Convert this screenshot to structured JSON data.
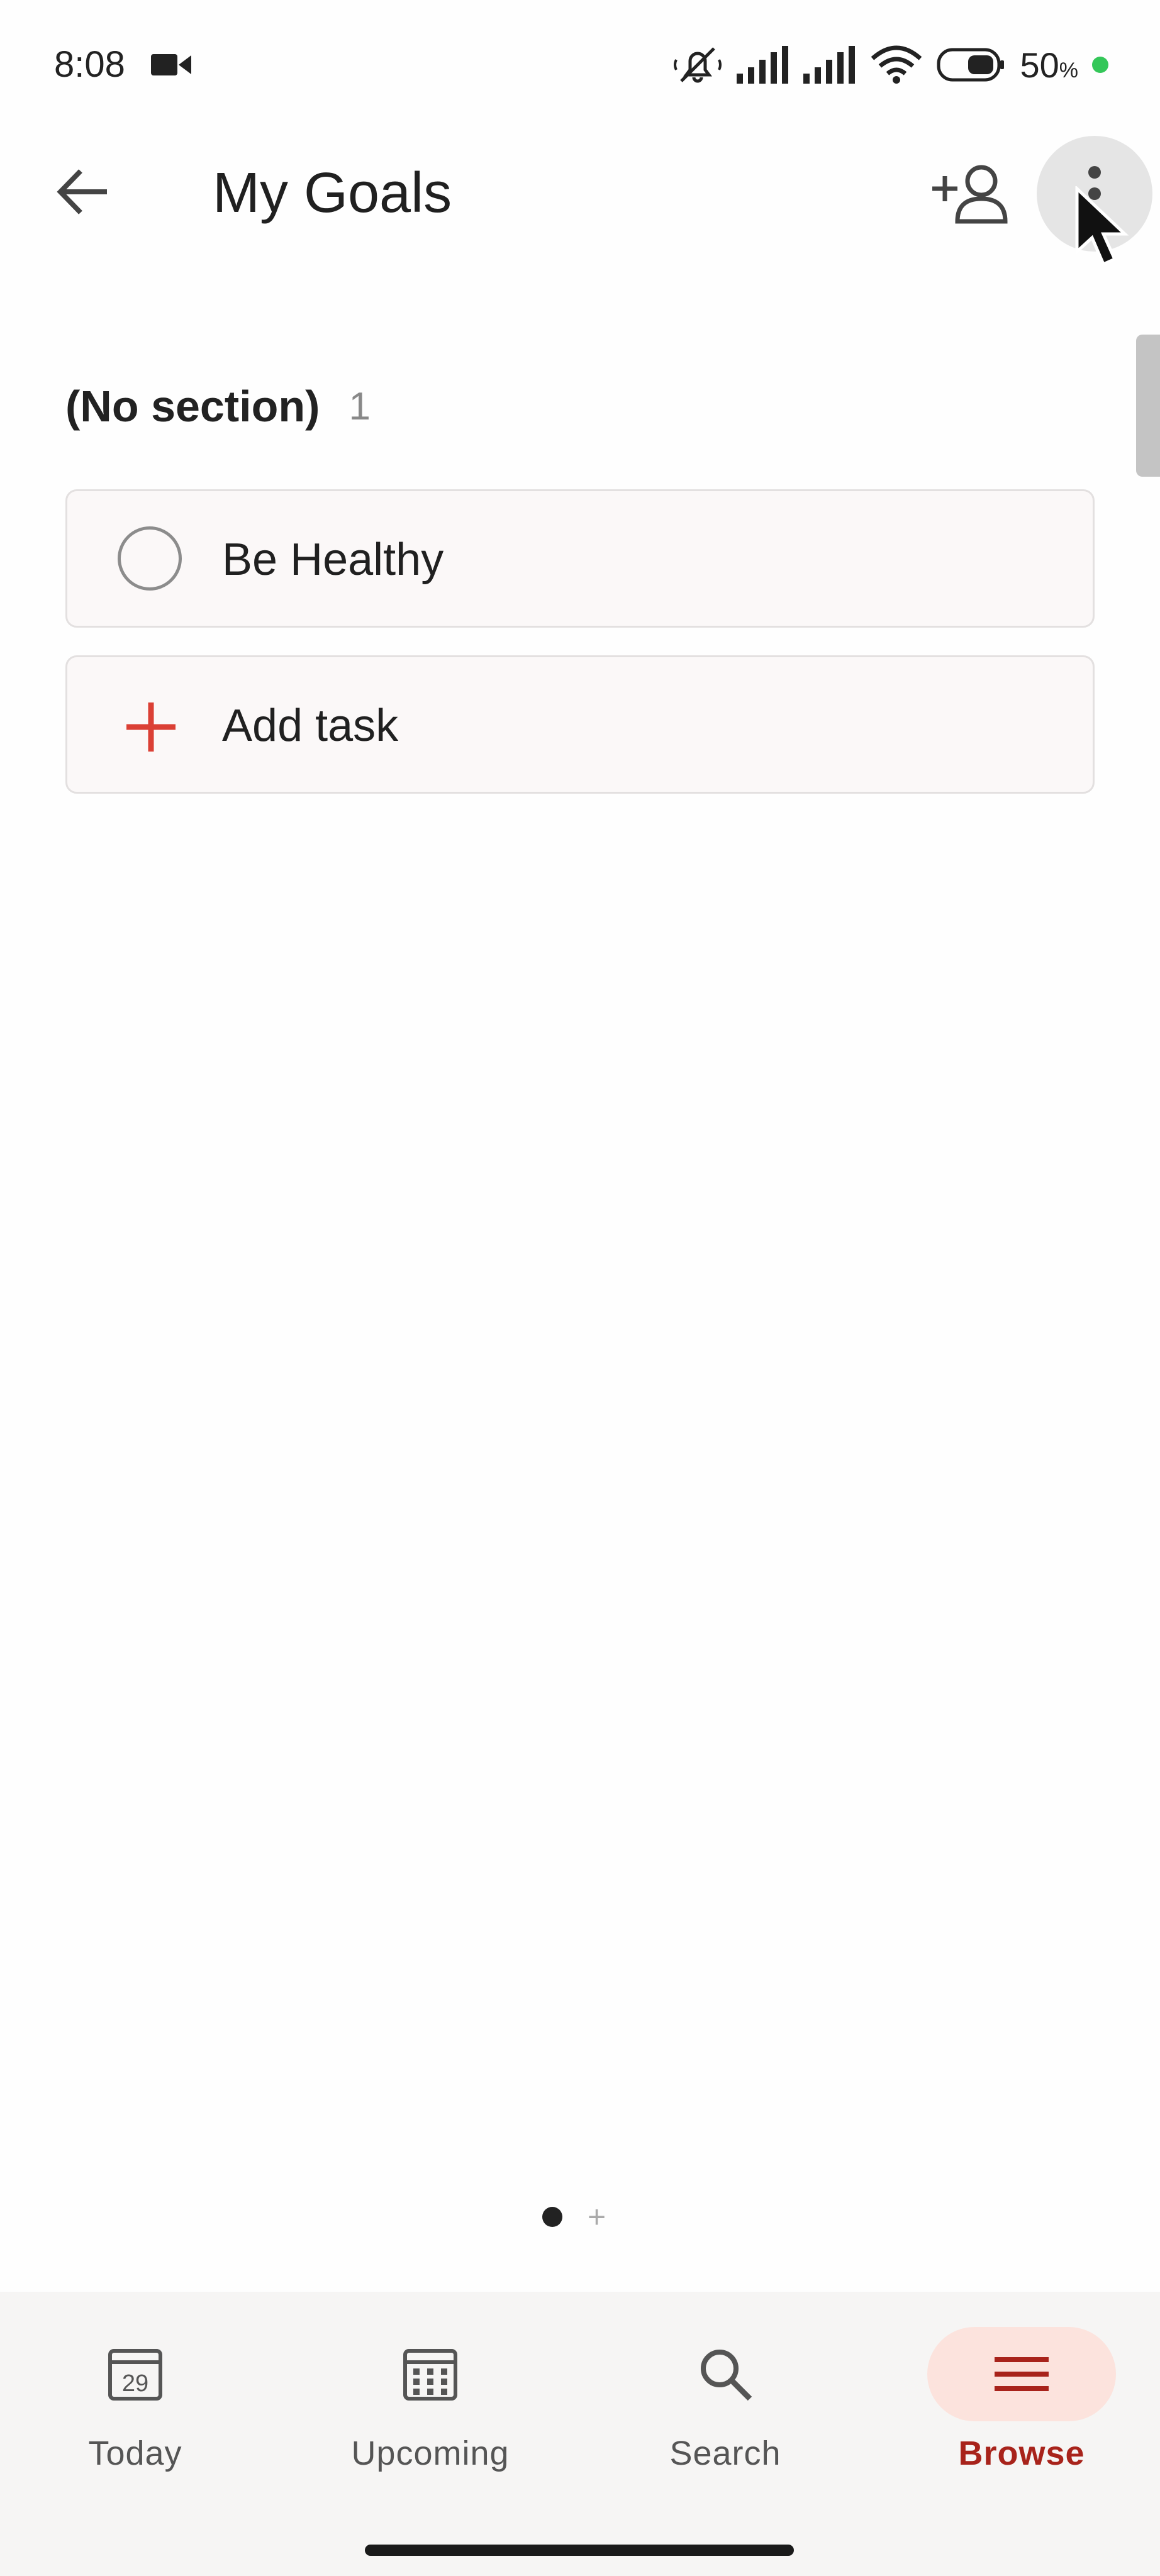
{
  "status_bar": {
    "time": "8:08",
    "battery_percent": "50",
    "battery_unit": "%",
    "icons": [
      "video-icon",
      "mute-icon",
      "signal-icon",
      "signal-icon",
      "wifi-icon",
      "battery-icon"
    ]
  },
  "app_bar": {
    "title": "My Goals",
    "icons": [
      "back-arrow-icon",
      "add-person-icon",
      "more-vertical-icon"
    ]
  },
  "section": {
    "name": "(No section)",
    "count": "1"
  },
  "tasks": [
    {
      "label": "Be Healthy",
      "completed": false
    }
  ],
  "add_task": {
    "label": "Add task",
    "icon": "plus-icon"
  },
  "page_indicator": {
    "active_index": 0,
    "add_symbol": "+"
  },
  "bottom_nav": {
    "items": [
      {
        "label": "Today",
        "icon": "calendar-today-icon",
        "day": "29",
        "active": false
      },
      {
        "label": "Upcoming",
        "icon": "calendar-grid-icon",
        "active": false
      },
      {
        "label": "Search",
        "icon": "search-icon",
        "active": false
      },
      {
        "label": "Browse",
        "icon": "menu-lines-icon",
        "active": true
      }
    ]
  },
  "colors": {
    "accent": "#db4035",
    "browse_active_text": "#a8231b",
    "browse_active_bg": "#fce3dd",
    "battery_dot": "#34c759"
  }
}
